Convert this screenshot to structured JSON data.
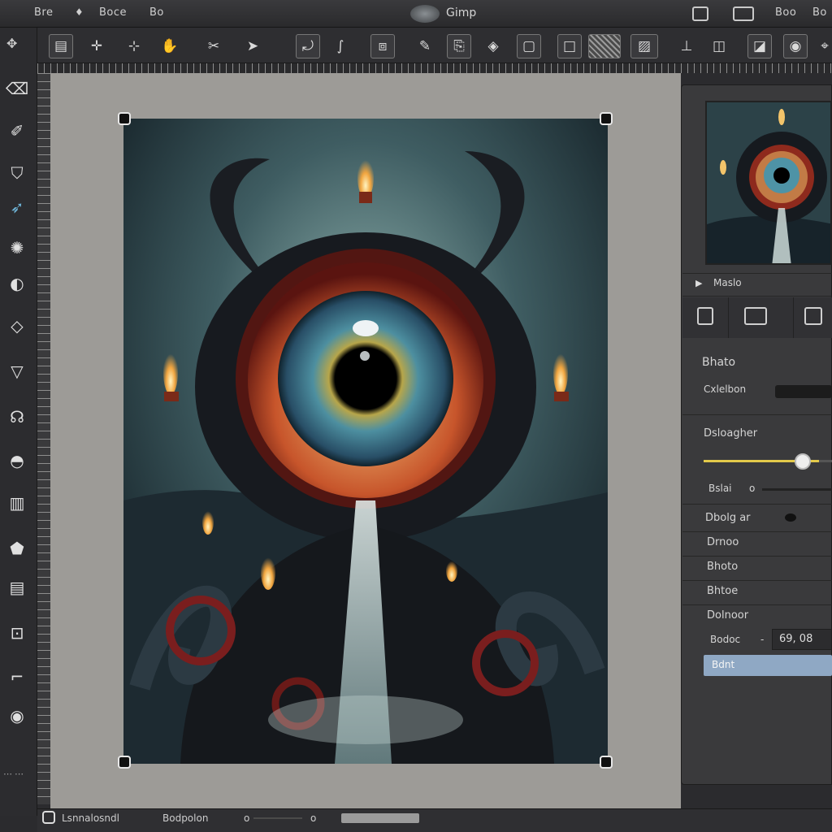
{
  "titlebar": {
    "menus": [
      "Bre",
      "Boce",
      "Bo"
    ],
    "app_title": "Gimp",
    "right_labels": [
      "Boo",
      "Bo"
    ]
  },
  "dock": {
    "layer_name": "Maslo",
    "section_title": "Bhato",
    "row1_label": "Cxlelbon",
    "slider_label": "Dsloagher",
    "slider_value": 0.9,
    "row3_label": "Bslai",
    "row3_value": "o",
    "row4_label": "Dbolg ar",
    "row5_label": "Drnoo",
    "row6_label": "Bhoto",
    "row7_label": "Bhtoe",
    "row8_label": "Dolnoor",
    "field_label": "Bodoc",
    "field_value": "69, 08",
    "field_dash": "-",
    "select_value": "Bdnt",
    "tab_icons": [
      "layers-icon",
      "channels-icon",
      "paths-icon"
    ]
  },
  "status": {
    "left_text": "Lsnnalosndl",
    "right_text": "Bodpolon",
    "dot": "o",
    "tail": "o"
  },
  "colors": {
    "accent": "#e3c94a",
    "select_bg": "#8fa8c4",
    "canvas_bg": "#9d9b97"
  }
}
